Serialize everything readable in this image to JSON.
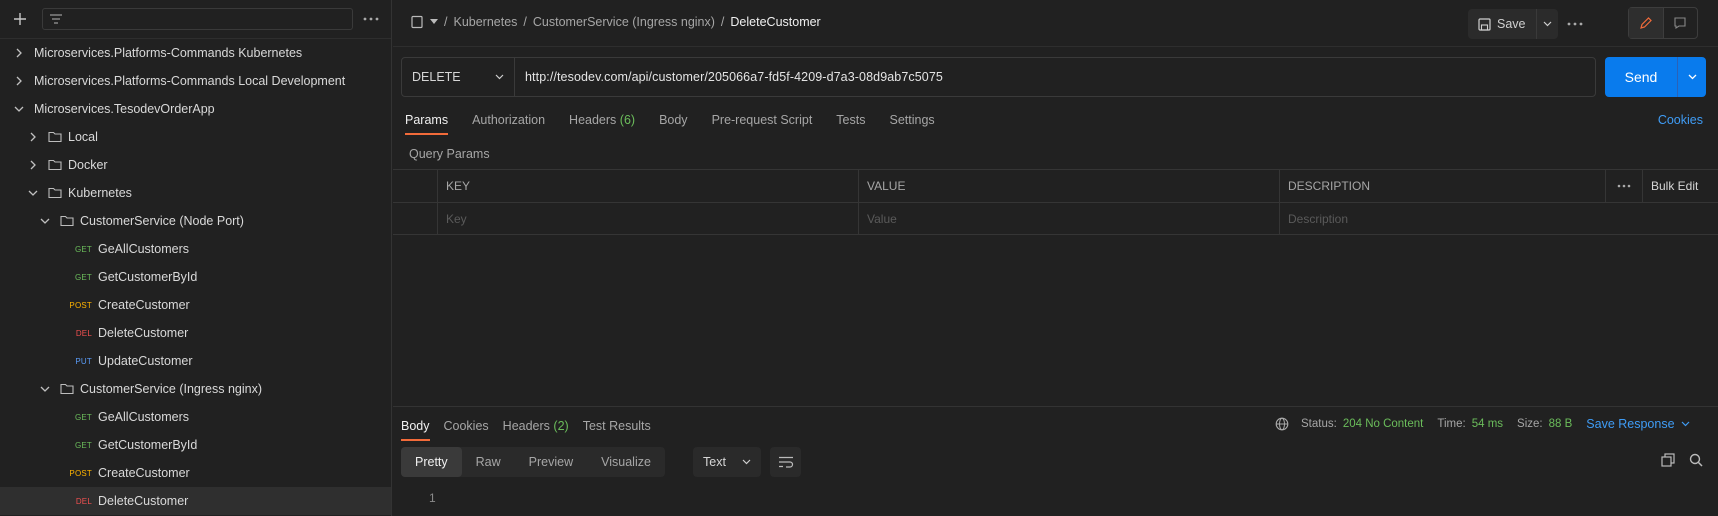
{
  "sidebar": {
    "tree": [
      {
        "label": "Microservices.Platforms-Commands Kubernetes",
        "type": "collection",
        "expanded": false
      },
      {
        "label": "Microservices.Platforms-Commands Local Development",
        "type": "collection",
        "expanded": false
      },
      {
        "label": "Microservices.TesodevOrderApp",
        "type": "collection",
        "expanded": true
      },
      {
        "label": "Local",
        "type": "folder",
        "expanded": false
      },
      {
        "label": "Docker",
        "type": "folder",
        "expanded": false
      },
      {
        "label": "Kubernetes",
        "type": "folder",
        "expanded": true
      },
      {
        "label": "CustomerService (Node Port)",
        "type": "folder",
        "expanded": true
      },
      {
        "label": "GeAllCustomers",
        "method": "GET"
      },
      {
        "label": "GetCustomerById",
        "method": "GET"
      },
      {
        "label": "CreateCustomer",
        "method": "POST"
      },
      {
        "label": "DeleteCustomer",
        "method": "DEL"
      },
      {
        "label": "UpdateCustomer",
        "method": "PUT"
      },
      {
        "label": "CustomerService (Ingress nginx)",
        "type": "folder",
        "expanded": true
      },
      {
        "label": "GeAllCustomers",
        "method": "GET"
      },
      {
        "label": "GetCustomerById",
        "method": "GET"
      },
      {
        "label": "CreateCustomer",
        "method": "POST"
      },
      {
        "label": "DeleteCustomer",
        "method": "DEL",
        "active": true
      }
    ]
  },
  "breadcrumb": {
    "sep": "/",
    "items": [
      "Kubernetes",
      "CustomerService (Ingress nginx)"
    ],
    "current": "DeleteCustomer"
  },
  "toolbar": {
    "save_label": "Save"
  },
  "request": {
    "method": "DELETE",
    "url": "http://tesodev.com/api/customer/205066a7-fd5f-4209-d7a3-08d9ab7c5075",
    "send_label": "Send"
  },
  "request_tabs": {
    "params": "Params",
    "authorization": "Authorization",
    "headers": "Headers",
    "headers_count": "(6)",
    "body": "Body",
    "prerequest": "Pre-request Script",
    "tests": "Tests",
    "settings": "Settings",
    "cookies": "Cookies"
  },
  "params": {
    "title": "Query Params",
    "col_key": "KEY",
    "col_value": "VALUE",
    "col_desc": "DESCRIPTION",
    "bulk_edit": "Bulk Edit",
    "ph_key": "Key",
    "ph_value": "Value",
    "ph_desc": "Description"
  },
  "response": {
    "tabs": {
      "body": "Body",
      "cookies": "Cookies",
      "headers": "Headers",
      "headers_count": "(2)",
      "test_results": "Test Results"
    },
    "status_label": "Status:",
    "status_value": "204 No Content",
    "time_label": "Time:",
    "time_value": "54 ms",
    "size_label": "Size:",
    "size_value": "88 B",
    "save_response": "Save Response",
    "formats": [
      "Pretty",
      "Raw",
      "Preview",
      "Visualize"
    ],
    "text_type": "Text",
    "line_number": "1"
  },
  "colors": {
    "accent": "#097bed",
    "ok": "#6bbd5b",
    "tab_underline": "#f26b3a",
    "link": "#3f9cf5"
  }
}
